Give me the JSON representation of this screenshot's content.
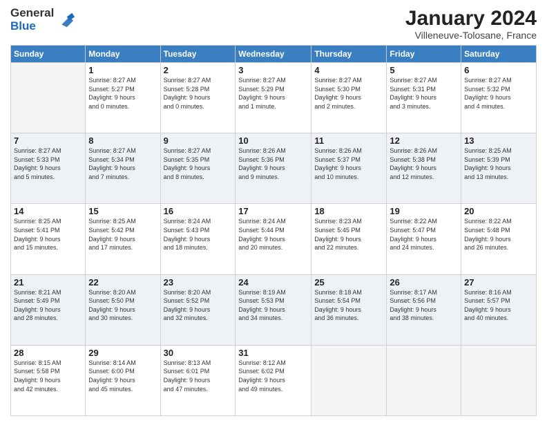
{
  "logo": {
    "general": "General",
    "blue": "Blue"
  },
  "header": {
    "title": "January 2024",
    "location": "Villeneuve-Tolosane, France"
  },
  "weekdays": [
    "Sunday",
    "Monday",
    "Tuesday",
    "Wednesday",
    "Thursday",
    "Friday",
    "Saturday"
  ],
  "weeks": [
    [
      {
        "day": "",
        "info": ""
      },
      {
        "day": "1",
        "info": "Sunrise: 8:27 AM\nSunset: 5:27 PM\nDaylight: 9 hours\nand 0 minutes."
      },
      {
        "day": "2",
        "info": "Sunrise: 8:27 AM\nSunset: 5:28 PM\nDaylight: 9 hours\nand 0 minutes."
      },
      {
        "day": "3",
        "info": "Sunrise: 8:27 AM\nSunset: 5:29 PM\nDaylight: 9 hours\nand 1 minute."
      },
      {
        "day": "4",
        "info": "Sunrise: 8:27 AM\nSunset: 5:30 PM\nDaylight: 9 hours\nand 2 minutes."
      },
      {
        "day": "5",
        "info": "Sunrise: 8:27 AM\nSunset: 5:31 PM\nDaylight: 9 hours\nand 3 minutes."
      },
      {
        "day": "6",
        "info": "Sunrise: 8:27 AM\nSunset: 5:32 PM\nDaylight: 9 hours\nand 4 minutes."
      }
    ],
    [
      {
        "day": "7",
        "info": "Sunrise: 8:27 AM\nSunset: 5:33 PM\nDaylight: 9 hours\nand 5 minutes."
      },
      {
        "day": "8",
        "info": "Sunrise: 8:27 AM\nSunset: 5:34 PM\nDaylight: 9 hours\nand 7 minutes."
      },
      {
        "day": "9",
        "info": "Sunrise: 8:27 AM\nSunset: 5:35 PM\nDaylight: 9 hours\nand 8 minutes."
      },
      {
        "day": "10",
        "info": "Sunrise: 8:26 AM\nSunset: 5:36 PM\nDaylight: 9 hours\nand 9 minutes."
      },
      {
        "day": "11",
        "info": "Sunrise: 8:26 AM\nSunset: 5:37 PM\nDaylight: 9 hours\nand 10 minutes."
      },
      {
        "day": "12",
        "info": "Sunrise: 8:26 AM\nSunset: 5:38 PM\nDaylight: 9 hours\nand 12 minutes."
      },
      {
        "day": "13",
        "info": "Sunrise: 8:25 AM\nSunset: 5:39 PM\nDaylight: 9 hours\nand 13 minutes."
      }
    ],
    [
      {
        "day": "14",
        "info": "Sunrise: 8:25 AM\nSunset: 5:41 PM\nDaylight: 9 hours\nand 15 minutes."
      },
      {
        "day": "15",
        "info": "Sunrise: 8:25 AM\nSunset: 5:42 PM\nDaylight: 9 hours\nand 17 minutes."
      },
      {
        "day": "16",
        "info": "Sunrise: 8:24 AM\nSunset: 5:43 PM\nDaylight: 9 hours\nand 18 minutes."
      },
      {
        "day": "17",
        "info": "Sunrise: 8:24 AM\nSunset: 5:44 PM\nDaylight: 9 hours\nand 20 minutes."
      },
      {
        "day": "18",
        "info": "Sunrise: 8:23 AM\nSunset: 5:45 PM\nDaylight: 9 hours\nand 22 minutes."
      },
      {
        "day": "19",
        "info": "Sunrise: 8:22 AM\nSunset: 5:47 PM\nDaylight: 9 hours\nand 24 minutes."
      },
      {
        "day": "20",
        "info": "Sunrise: 8:22 AM\nSunset: 5:48 PM\nDaylight: 9 hours\nand 26 minutes."
      }
    ],
    [
      {
        "day": "21",
        "info": "Sunrise: 8:21 AM\nSunset: 5:49 PM\nDaylight: 9 hours\nand 28 minutes."
      },
      {
        "day": "22",
        "info": "Sunrise: 8:20 AM\nSunset: 5:50 PM\nDaylight: 9 hours\nand 30 minutes."
      },
      {
        "day": "23",
        "info": "Sunrise: 8:20 AM\nSunset: 5:52 PM\nDaylight: 9 hours\nand 32 minutes."
      },
      {
        "day": "24",
        "info": "Sunrise: 8:19 AM\nSunset: 5:53 PM\nDaylight: 9 hours\nand 34 minutes."
      },
      {
        "day": "25",
        "info": "Sunrise: 8:18 AM\nSunset: 5:54 PM\nDaylight: 9 hours\nand 36 minutes."
      },
      {
        "day": "26",
        "info": "Sunrise: 8:17 AM\nSunset: 5:56 PM\nDaylight: 9 hours\nand 38 minutes."
      },
      {
        "day": "27",
        "info": "Sunrise: 8:16 AM\nSunset: 5:57 PM\nDaylight: 9 hours\nand 40 minutes."
      }
    ],
    [
      {
        "day": "28",
        "info": "Sunrise: 8:15 AM\nSunset: 5:58 PM\nDaylight: 9 hours\nand 42 minutes."
      },
      {
        "day": "29",
        "info": "Sunrise: 8:14 AM\nSunset: 6:00 PM\nDaylight: 9 hours\nand 45 minutes."
      },
      {
        "day": "30",
        "info": "Sunrise: 8:13 AM\nSunset: 6:01 PM\nDaylight: 9 hours\nand 47 minutes."
      },
      {
        "day": "31",
        "info": "Sunrise: 8:12 AM\nSunset: 6:02 PM\nDaylight: 9 hours\nand 49 minutes."
      },
      {
        "day": "",
        "info": ""
      },
      {
        "day": "",
        "info": ""
      },
      {
        "day": "",
        "info": ""
      }
    ]
  ]
}
